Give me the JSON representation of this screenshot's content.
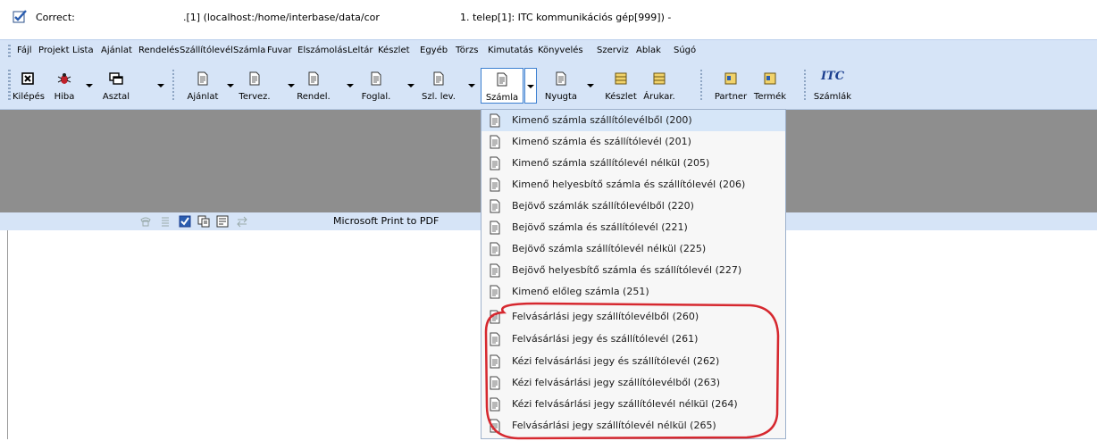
{
  "title": {
    "app": "Correct:",
    "path": ".[1] (localhost:/home/interbase/data/cor",
    "site": "1. telep[1]: ITC kommunikációs gép[999]) -"
  },
  "menu": [
    "Fájl",
    "Projekt",
    "Lista",
    "Ajánlat",
    "Rendelés",
    "Szállítólevél",
    "Számla",
    "Fuvar",
    "Elszámolás",
    "Leltár",
    "Készlet",
    "Egyéb",
    "Törzs",
    "Kimutatás",
    "Könyvelés",
    "Szerviz",
    "Ablak",
    "Súgó"
  ],
  "toolbar": {
    "kilepes": "Kilépés",
    "hiba": "Hiba",
    "asztal": "Asztal",
    "ajanlat": "Ajánlat",
    "tervez": "Tervez.",
    "rendel": "Rendel.",
    "foglal": "Foglal.",
    "szllev": "Szl. lev.",
    "szamla": "Számla",
    "nyugta": "Nyugta",
    "keszlet": "Készlet",
    "arukar": "Árukar.",
    "partner": "Partner",
    "termek": "Termék",
    "szamlak": "Számlák",
    "itc_glyph": "ITC"
  },
  "status": {
    "printer": "Microsoft Print to PDF"
  },
  "dropdown": [
    "Kimenő számla szállítólevélből (200)",
    "Kimenő számla és szállítólevél (201)",
    "Kimenő számla szállítólevél nélkül (205)",
    "Kimenő helyesbítő számla és szállítólevél (206)",
    "Bejövő számlák szállítólevélből (220)",
    "Bejövő számla és szállítólevél (221)",
    "Bejövő számla szállítólevél nélkül (225)",
    "Bejövő helyesbítő számla és szállítólevél (227)",
    "Kimenő előleg számla (251)",
    "Felvásárlási jegy szállítólevélből (260)",
    "Felvásárlási jegy és szállítólevél (261)",
    "Kézi felvásárlási jegy és szállítólevél (262)",
    "Kézi felvásárlási jegy szállítólevélből (263)",
    "Kézi felvásárlási jegy szállítólevél nélkül (264)",
    "Felvásárlási jegy szállítólevél nélkül (265)"
  ],
  "colors": {
    "highlight_oval": "#d6282f",
    "bar": "#d6e4f7",
    "gray_area": "#8e8e8e"
  }
}
